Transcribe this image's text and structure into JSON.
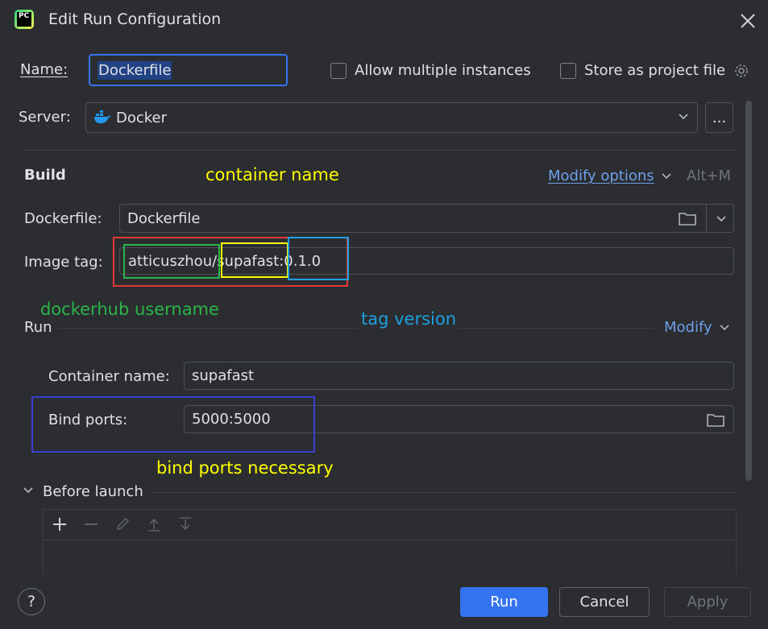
{
  "window": {
    "title": "Edit Run Configuration",
    "logo_text": "PC"
  },
  "name": {
    "label": "Name:",
    "value": "Dockerfile"
  },
  "options": {
    "allow_multiple": "Allow multiple instances",
    "store_project": "Store as project file"
  },
  "server": {
    "label": "Server:",
    "value": "Docker",
    "browse": "..."
  },
  "build": {
    "section": "Build",
    "modify_options": "Modify options",
    "shortcut": "Alt+M",
    "dockerfile_label": "Dockerfile:",
    "dockerfile_value": "Dockerfile",
    "image_tag_label": "Image tag:",
    "image_tag_user": "atticuszhou/",
    "image_tag_repo": "supafast:",
    "image_tag_version": "0.1.0"
  },
  "run": {
    "section": "Run",
    "modify": "Modify",
    "container_name_label": "Container name:",
    "container_name_value": "supafast",
    "bind_ports_label": "Bind ports:",
    "bind_ports_value": "5000:5000"
  },
  "before_launch": {
    "label": "Before launch"
  },
  "annotations": {
    "container_name": "container name",
    "dockerhub_username": "dockerhub username",
    "tag_version": "tag version",
    "bind_ports": "bind ports necessary"
  },
  "footer": {
    "help": "?",
    "run": "Run",
    "cancel": "Cancel",
    "apply": "Apply"
  },
  "colors": {
    "accent": "#3574f0",
    "annotation_yellow": "#ffff00",
    "annotation_green": "#2bb44a",
    "annotation_cyan": "#1ea0e0",
    "annotation_red": "#e53935",
    "annotation_indigo": "#3a3fd0"
  }
}
